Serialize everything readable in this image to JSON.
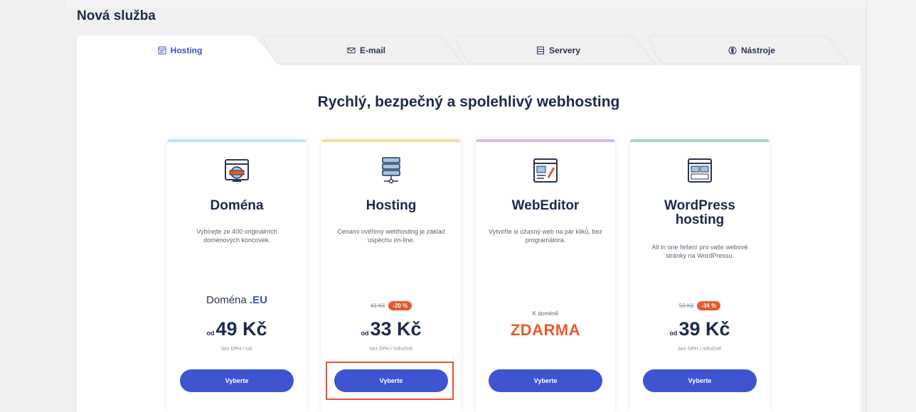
{
  "page": {
    "title": "Nová služba"
  },
  "tabs": [
    {
      "label": "Hosting",
      "icon": "hosting-icon",
      "active": true
    },
    {
      "label": "E-mail",
      "icon": "envelope-icon",
      "active": false
    },
    {
      "label": "Servery",
      "icon": "server-icon",
      "active": false
    },
    {
      "label": "Nástroje",
      "icon": "tools-icon",
      "active": false
    }
  ],
  "main": {
    "headline": "Rychlý, bezpečný a spolehlivý webhosting",
    "cards": [
      {
        "name": "Doména",
        "description": "Vybírejte ze 400 originálních doménových koncovek.",
        "domain_label": "Doména",
        "domain_ext": ".EU",
        "price_prefix": "od",
        "price": "49 Kč",
        "price_note": "bez DPH / rok",
        "button": "Vyberte",
        "accent_color": "#bfe3f3",
        "icon": "domain-icon"
      },
      {
        "name": "Hosting",
        "description": "Cenami ověřený webhosting je základ úspěchu on-line.",
        "old_price": "41 Kč",
        "discount": "-20 %",
        "price_prefix": "od",
        "price": "33 Kč",
        "price_note": "bez DPH / měsíčně",
        "button": "Vyberte",
        "accent_color": "#f3e0a0",
        "icon": "server-stack-icon"
      },
      {
        "name": "WebEditor",
        "description": "Vytvořte si úžasný web na pár kliků, bez programátora.",
        "free_label": "K doméně",
        "free_price": "ZDARMA",
        "button": "Vyberte",
        "accent_color": "#d9b8ea",
        "icon": "web-editor-icon"
      },
      {
        "name": "WordPress hosting",
        "description": "All in one řešení pro vaše webové stránky na WordPressu.",
        "old_price": "59 Kč",
        "discount": "-34 %",
        "price_prefix": "od",
        "price": "39 Kč",
        "price_note": "bez DPH / měsíčně",
        "button": "Vyberte",
        "accent_color": "#a9d3c4",
        "icon": "wordpress-layout-icon"
      }
    ]
  },
  "colors": {
    "brand_blue": "#3d55d1",
    "accent_orange": "#e55b2c",
    "highlight_red": "#e2523a",
    "text_dark": "#1d2a48"
  }
}
